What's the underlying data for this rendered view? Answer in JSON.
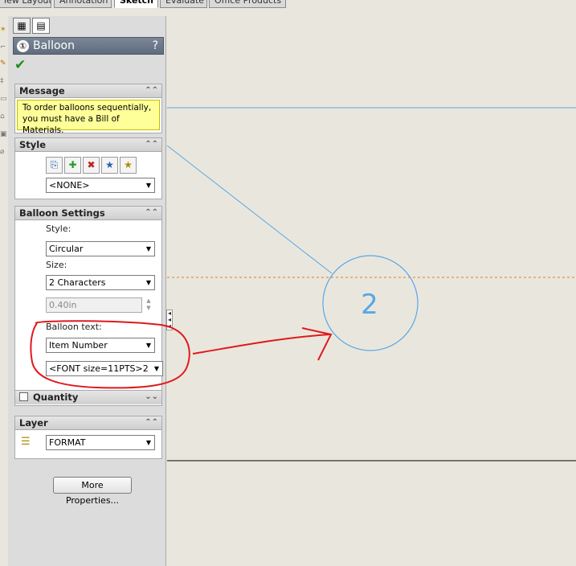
{
  "tabs": [
    "iew Layout",
    "Annotation",
    "Sketch",
    "Evaluate",
    "Office Products"
  ],
  "active_tab": "Sketch",
  "property_manager": {
    "title": "Balloon",
    "help": "?",
    "ok": "✔",
    "message": {
      "header": "Message",
      "text": "To order balloons sequentially, you must have a Bill of Materials."
    },
    "style": {
      "header": "Style",
      "combo_value": "<NONE>"
    },
    "balloon_settings": {
      "header": "Balloon Settings",
      "style_label": "Style:",
      "style_value": "Circular",
      "size_label": "Size:",
      "size_value": "2 Characters",
      "custom_size_value": "0.40in",
      "balloon_text_label": "Balloon text:",
      "balloon_text_value": "Item Number",
      "font_value": "<FONT size=11PTS>2"
    },
    "quantity": {
      "header": "Quantity",
      "checked": false
    },
    "layer": {
      "header": "Layer",
      "value": "FORMAT"
    },
    "more_properties": "More Properties..."
  },
  "canvas": {
    "balloon_number": "2",
    "colors": {
      "background": "#e9e7dd",
      "balloon_blue": "#5aa6e6",
      "annotation_red": "#e0191e",
      "dashed_orange": "#e07a2a"
    }
  }
}
